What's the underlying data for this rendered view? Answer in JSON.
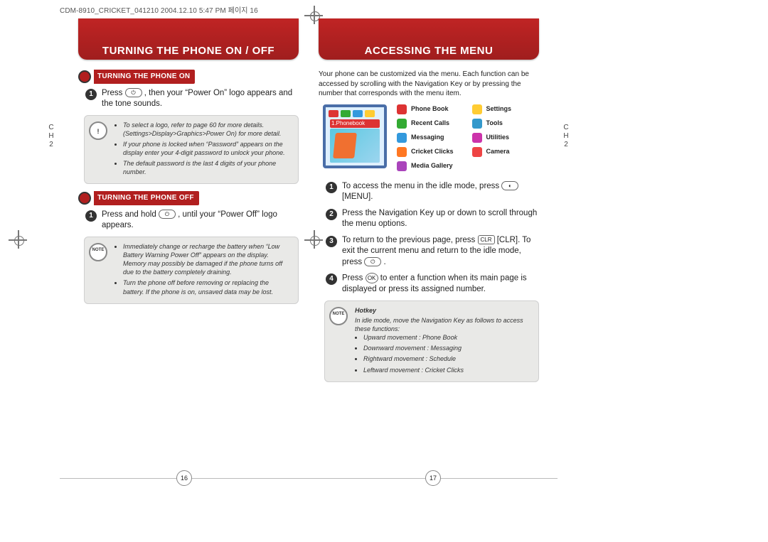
{
  "header_line": "CDM-8910_CRICKET_041210  2004.12.10 5:47 PM 페이지 16",
  "ch_label": "C\nH\n2",
  "left_page": {
    "banner": "TURNING THE PHONE ON / OFF",
    "sub_on": "TURNING THE PHONE ON",
    "on_step1": "Press        , then your “Power On” logo appears and the tone sounds.",
    "on_note": [
      "To select a logo, refer to page 60 for more details. (Settings>Display>Graphics>Power On) for more detail.",
      "If your phone is locked when “Password” appears on the display enter your 4-digit password to unlock your phone.",
      "The default password is the last 4 digits of your phone number."
    ],
    "sub_off": "TURNING THE PHONE OFF",
    "off_step1": "Press and hold       , until your “Power Off” logo appears.",
    "off_note": [
      "Immediately change or recharge the battery when “Low Battery Warning Power Off” appears on the display. Memory may possibly be damaged if the phone turns off due to the battery completely draining.",
      "Turn the phone off before removing or replacing the battery. If the phone is on, unsaved data may be lost."
    ],
    "page_number": "16"
  },
  "right_page": {
    "banner": "ACCESSING THE MENU",
    "intro": "Your phone can be customized via the menu. Each function can be accessed by scrolling with the Navigation Key or by pressing the number that corresponds with the menu item.",
    "phone_label": "1.Phonebook",
    "menu_col1": [
      "Phone Book",
      "Recent Calls",
      "Messaging",
      "Cricket Clicks",
      "Media Gallery"
    ],
    "menu_col2": [
      "Settings",
      "Tools",
      "Utilities",
      "Camera"
    ],
    "steps": [
      "To access the menu in the idle mode, press        [MENU].",
      "Press the Navigation Key up or down to scroll through the menu options.",
      "To return to the previous page, press        [CLR]. To exit the current menu and return to the idle mode, press        .",
      "Press        to enter a function when its main page is displayed or press its assigned number."
    ],
    "hotkey_title": "Hotkey",
    "hotkey_intro": "In idle mode, move the Navigation Key as follows to access these functions:",
    "hotkey_items": [
      "Upward movement : Phone Book",
      "Downward movement : Messaging",
      "Rightward movement : Schedule",
      "Leftward movement : Cricket Clicks"
    ],
    "page_number": "17"
  }
}
